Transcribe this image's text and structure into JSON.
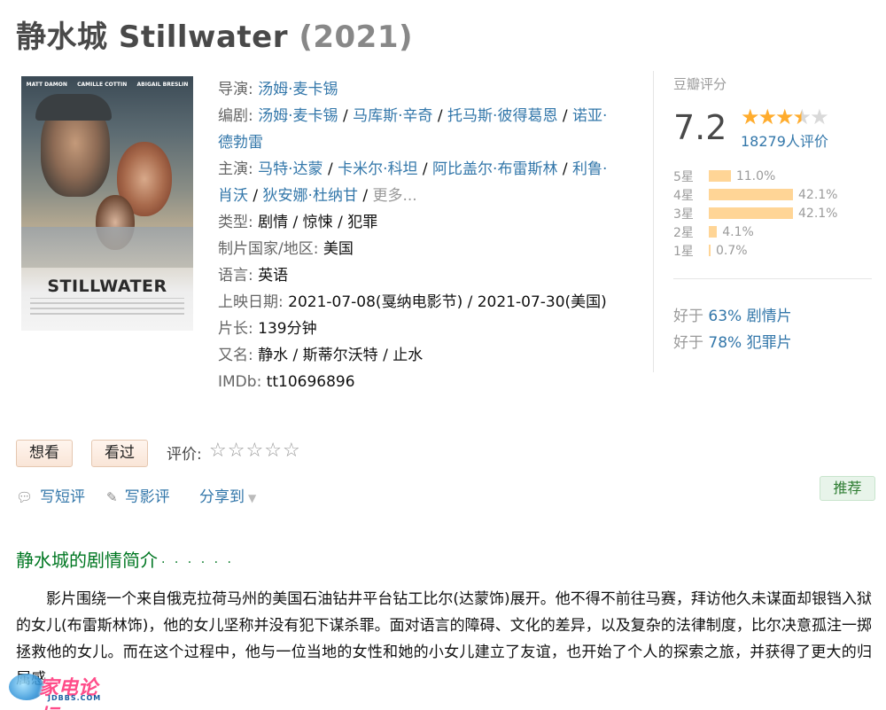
{
  "header": {
    "title_cn": "静水城",
    "title_en": "Stillwater",
    "year": "(2021)"
  },
  "poster": {
    "credits": [
      "MATT DAMON",
      "CAMILLE COTTIN",
      "ABIGAIL BRESLIN"
    ],
    "logo_text": "STILLWATER"
  },
  "info": {
    "director_label": "导演:",
    "director": [
      "汤姆·麦卡锡"
    ],
    "writer_label": "编剧:",
    "writers": [
      "汤姆·麦卡锡",
      "马库斯·辛奇",
      "托马斯·彼得葛恩",
      "诺亚·",
      "德勃雷"
    ],
    "cast_label": "主演:",
    "cast": [
      "马特·达蒙",
      "卡米尔·科坦",
      "阿比盖尔·布雷斯林",
      "利鲁·",
      "肖沃",
      "狄安娜·杜纳甘"
    ],
    "cast_more": "更多...",
    "genre_label": "类型:",
    "genre": "剧情 / 惊悚 / 犯罪",
    "country_label": "制片国家/地区:",
    "country": "美国",
    "language_label": "语言:",
    "language": "英语",
    "release_label": "上映日期:",
    "release": "2021-07-08(戛纳电影节) / 2021-07-30(美国)",
    "runtime_label": "片长:",
    "runtime": "139分钟",
    "aka_label": "又名:",
    "aka": "静水 / 斯蒂尔沃特 / 止水",
    "imdb_label": "IMDb:",
    "imdb": "tt10696896"
  },
  "rating": {
    "title": "豆瓣评分",
    "score": "7.2",
    "stars": 3.5,
    "count": "18279人评价",
    "distribution": [
      {
        "label": "5星",
        "percent": "11.0%",
        "value": 11.0
      },
      {
        "label": "4星",
        "percent": "42.1%",
        "value": 42.1
      },
      {
        "label": "3星",
        "percent": "42.1%",
        "value": 42.1
      },
      {
        "label": "2星",
        "percent": "4.1%",
        "value": 4.1
      },
      {
        "label": "1星",
        "percent": "0.7%",
        "value": 0.7
      }
    ],
    "better_than": [
      {
        "prefix": "好于",
        "pct": "63%",
        "genre": "剧情片"
      },
      {
        "prefix": "好于",
        "pct": "78%",
        "genre": "犯罪片"
      }
    ]
  },
  "actions": {
    "want": "想看",
    "seen": "看过",
    "rate_label": "评价:",
    "short_review": "写短评",
    "review": "写影评",
    "share": "分享到",
    "recommend": "推荐"
  },
  "summary": {
    "title": "静水城的剧情简介",
    "dots": "· · · · · ·",
    "text": "影片围绕一个来自俄克拉荷马州的美国石油钻井平台钻工比尔(达蒙饰)展开。他不得不前往马赛，拜访他久未谋面却银铛入狱的女儿(布雷斯林饰)，他的女儿坚称并没有犯下谋杀罪。面对语言的障碍、文化的差异，以及复杂的法律制度，比尔决意孤注一掷拯救他的女儿。而在这个过程中，他与一位当地的女性和她的小女儿建立了友谊，也开始了个人的探索之旅，并获得了更大的归属感。"
  },
  "watermark": {
    "text": "家电论坛",
    "sub": "JDBBS.COM"
  },
  "colors": {
    "link": "#3377aa",
    "green": "#007722",
    "star": "#ffac2d",
    "bar": "#ffd596"
  }
}
